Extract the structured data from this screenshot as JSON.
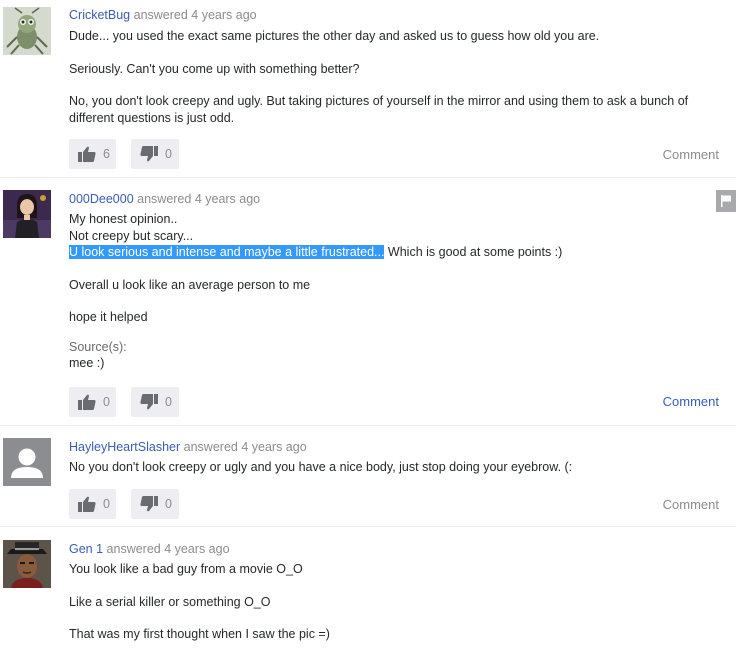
{
  "answers": [
    {
      "username": "CricketBug",
      "meta": "answered 4 years ago",
      "lines": [
        "Dude... you used the exact same pictures the other day and asked us to guess how old you are.",
        "",
        "Seriously. Can't you come up with something better?",
        "",
        "No, you don't look creepy and ugly. But taking pictures of yourself in the mirror and using them to ask a bunch of different questions is just odd."
      ],
      "upvotes": "6",
      "downvotes": "0",
      "comment_label": "Comment"
    },
    {
      "username": "000Dee000",
      "meta": "answered 4 years ago",
      "line1": "My honest opinion..",
      "line2": "Not creepy but scary...",
      "line3_highlighted": "U look serious and intense and maybe a little frustrated...",
      "line3_rest": " Which is good at some points :)",
      "line4": "Overall u look like an average person to me",
      "line5": "hope it helped",
      "sources_label": "Source(s):",
      "sources_value": "mee :)",
      "upvotes": "0",
      "downvotes": "0",
      "comment_label": "Comment"
    },
    {
      "username": "HayleyHeartSlasher",
      "meta": "answered 4 years ago",
      "line1": "No you don't look creepy or ugly and you have a nice body, just stop doing your eyebrow. (:",
      "upvotes": "0",
      "downvotes": "0",
      "comment_label": "Comment"
    },
    {
      "username": "Gen 1",
      "meta": "answered 4 years ago",
      "line1": "You look like a bad guy from a movie O_O",
      "line2": "Like a serial killer or something O_O",
      "line3": "That was my first thought when I saw the pic =)"
    }
  ],
  "icons": {
    "thumbs_up": "thumbs-up-icon",
    "thumbs_down": "thumbs-down-icon",
    "flag": "flag-icon",
    "default_avatar": "default-user-avatar"
  },
  "colors": {
    "username_link": "#3a5cb4",
    "selection_highlight": "#3399ff",
    "vote_button_bg": "#eeeef2",
    "icon_gray": "#696b70",
    "flag_bg": "#a7a9ad"
  }
}
